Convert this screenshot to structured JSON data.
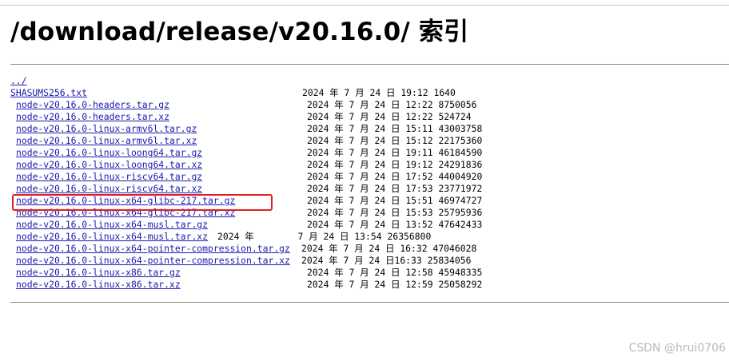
{
  "page": {
    "title": "/download/release/v20.16.0/ 索引",
    "watermark": "CSDN @hrui0706"
  },
  "entries": [
    {
      "name": "../",
      "meta": ""
    },
    {
      "name": "SHASUMS256.txt",
      "meta": "2024 年 7 月 24 日 19:12 1640"
    },
    {
      "name": "node-v20.16.0-headers.tar.gz",
      "meta": "2024 年 7 月 24 日 12:22 8750056"
    },
    {
      "name": "node-v20.16.0-headers.tar.xz",
      "meta": "2024 年 7 月 24 日 12:22 524724"
    },
    {
      "name": "node-v20.16.0-linux-armv6l.tar.gz",
      "meta": "2024 年 7 月 24 日 15:11 43003758"
    },
    {
      "name": "node-v20.16.0-linux-armv6l.tar.xz",
      "meta": "2024 年 7 月 24 日 15:12 22175360"
    },
    {
      "name": "node-v20.16.0-linux-loong64.tar.gz",
      "meta": "2024 年 7 月 24 日 19:11 46184590"
    },
    {
      "name": "node-v20.16.0-linux-loong64.tar.xz",
      "meta": "2024 年 7 月 24 日 19:12 24291836"
    },
    {
      "name": "node-v20.16.0-linux-riscv64.tar.gz",
      "meta": "2024 年 7 月 24 日 17:52 44004920"
    },
    {
      "name": "node-v20.16.0-linux-riscv64.tar.xz",
      "meta": "2024 年 7 月 24 日 17:53 23771972"
    },
    {
      "name": "node-v20.16.0-linux-x64-glibc-217.tar.gz",
      "meta": "2024 年 7 月 24 日 15:51 46974727"
    },
    {
      "name": "node-v20.16.0-linux-x64-glibc-217.tar.xz",
      "meta": "2024 年 7 月 24 日 15:53 25795936"
    },
    {
      "name": "node-v20.16.0-linux-x64-musl.tar.gz",
      "meta": "2024 年 7 月 24 日 13:52 47642433"
    },
    {
      "name": "node-v20.16.0-linux-x64-musl.tar.xz",
      "meta": "2024 年        7 月 24 日 13:54 26356800"
    },
    {
      "name": "node-v20.16.0-linux-x64-pointer-compression.tar.gz",
      "meta": "2024 年 7 月 24 日 16:32 47046028"
    },
    {
      "name": "node-v20.16.0-linux-x64-pointer-compression.tar.xz",
      "meta": "2024 年 7 月 24 日16:33 25834056"
    },
    {
      "name": "node-v20.16.0-linux-x86.tar.gz",
      "meta": "2024 年 7 月 24 日 12:58 45948335"
    },
    {
      "name": "node-v20.16.0-linux-x86.tar.xz",
      "meta": "2024 年 7 月 24 日 12:59 25058292"
    }
  ]
}
